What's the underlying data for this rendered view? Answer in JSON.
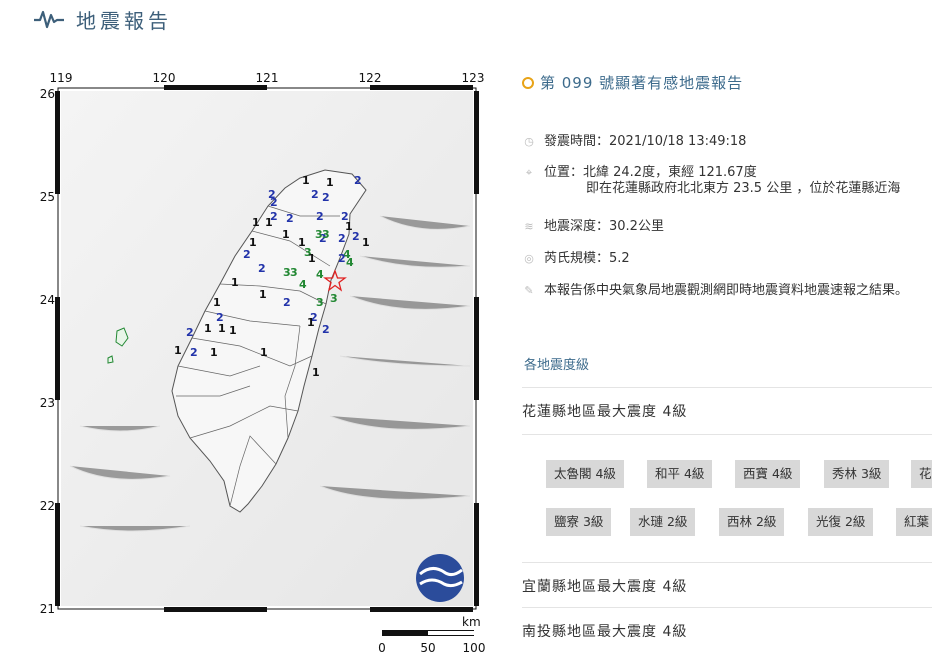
{
  "header": {
    "title": "地震報告"
  },
  "map": {
    "lon_ticks": [
      "119",
      "120",
      "121",
      "122",
      "123"
    ],
    "lat_ticks": [
      "26",
      "25",
      "24",
      "23",
      "22",
      "21"
    ],
    "scale_unit": "km",
    "scale_labels": [
      "0",
      "50",
      "100"
    ],
    "intensity_labels": [
      {
        "t": "2",
        "c": "#2233aa"
      },
      {
        "t": "2",
        "c": "#2233aa"
      },
      {
        "t": "1",
        "c": "#111"
      },
      {
        "t": "2",
        "c": "#2233aa"
      },
      {
        "t": "2",
        "c": "#2233aa"
      },
      {
        "t": "1",
        "c": "#111"
      },
      {
        "t": "2",
        "c": "#2233aa"
      },
      {
        "t": "1",
        "c": "#111"
      },
      {
        "t": "1",
        "c": "#111"
      },
      {
        "t": "1",
        "c": "#111"
      },
      {
        "t": "2",
        "c": "#2233aa"
      },
      {
        "t": "2",
        "c": "#2233aa"
      },
      {
        "t": "2",
        "c": "#2233aa"
      },
      {
        "t": "2",
        "c": "#2233aa"
      },
      {
        "t": "1",
        "c": "#111"
      },
      {
        "t": "2",
        "c": "#2233aa"
      },
      {
        "t": "1",
        "c": "#111"
      },
      {
        "t": "1",
        "c": "#111"
      },
      {
        "t": "2",
        "c": "#2233aa"
      },
      {
        "t": "3",
        "c": "#228833"
      },
      {
        "t": "3",
        "c": "#228833"
      },
      {
        "t": "2",
        "c": "#2233aa"
      },
      {
        "t": "2",
        "c": "#2233aa"
      },
      {
        "t": "4",
        "c": "#228833"
      },
      {
        "t": "2",
        "c": "#2233aa"
      },
      {
        "t": "3",
        "c": "#228833"
      },
      {
        "t": "2",
        "c": "#2233aa"
      },
      {
        "t": "3",
        "c": "#228833"
      },
      {
        "t": "3",
        "c": "#228833"
      },
      {
        "t": "4",
        "c": "#228833"
      },
      {
        "t": "4",
        "c": "#228833"
      },
      {
        "t": "1",
        "c": "#111"
      },
      {
        "t": "1",
        "c": "#111"
      },
      {
        "t": "1",
        "c": "#111"
      },
      {
        "t": "3",
        "c": "#228833"
      },
      {
        "t": "4",
        "c": "#228833"
      },
      {
        "t": "1",
        "c": "#111"
      },
      {
        "t": "2",
        "c": "#2233aa"
      },
      {
        "t": "1",
        "c": "#111"
      },
      {
        "t": "3",
        "c": "#228833"
      },
      {
        "t": "2",
        "c": "#2233aa"
      },
      {
        "t": "2",
        "c": "#2233aa"
      },
      {
        "t": "1",
        "c": "#111"
      },
      {
        "t": "1",
        "c": "#111"
      },
      {
        "t": "2",
        "c": "#2233aa"
      },
      {
        "t": "2",
        "c": "#2233aa"
      },
      {
        "t": "2",
        "c": "#2233aa"
      },
      {
        "t": "1",
        "c": "#111"
      },
      {
        "t": "1",
        "c": "#111"
      },
      {
        "t": "1",
        "c": "#111"
      },
      {
        "t": "1",
        "c": "#111"
      },
      {
        "t": "1",
        "c": "#111"
      },
      {
        "t": "1",
        "c": "#111"
      }
    ]
  },
  "report": {
    "title": "第 099 號顯著有感地震報告",
    "time": "發震時間：2021/10/18 13:49:18",
    "location": "位置：北緯 24.2度，東經 121.67度",
    "location_detail": "即在花蓮縣政府北北東方 23.5 公里 ，位於花蓮縣近海",
    "depth": "地震深度：30.2公里",
    "magnitude": "芮氏規模：5.2",
    "note": "本報告係中央氣象局地震觀測網即時地震資料地震速報之結果。",
    "intensity_link": "各地震度級",
    "counties": [
      {
        "label": "花蓮縣地區最大震度 4級",
        "stations": [
          "太魯閣 4級",
          "和平 4級",
          "西寶 4級",
          "秀林 3級",
          "花",
          "鹽寮 3級",
          "水璉 2級",
          "西林 2級",
          "光復 2級",
          "紅葉"
        ]
      },
      {
        "label": "宜蘭縣地區最大震度 4級"
      },
      {
        "label": "南投縣地區最大震度 4級"
      }
    ]
  }
}
